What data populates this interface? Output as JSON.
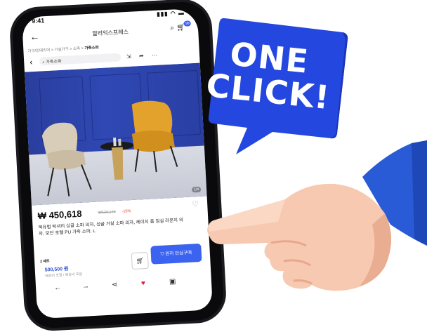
{
  "status": {
    "time": "9:41",
    "icons": "▮▮▮ ◠ ▬"
  },
  "appbar": {
    "title": "알리익스프레스",
    "cart_badge": "99"
  },
  "breadcrumb": {
    "path": "가구/인테리어 > 거실가구 > 소파 > ",
    "current": "가죽소파"
  },
  "search": {
    "value": "가죽소파"
  },
  "product": {
    "image_counter": "1/4",
    "price": "₩ 450,618",
    "original_price": "₩530,140",
    "discount": "-15%",
    "description": "북유럽 럭셔리 싱글 소파 의자, 싱글 거실 소파 의자, 레이지 홈 침실 라운지 의자, 모던 호텔 PU 가죽 소파, L"
  },
  "purchase": {
    "qty_label": "2 세트",
    "price": "500,500 원",
    "note": "배송비 포함 / 배송비 포함",
    "buy_label": "원리 안심구매"
  },
  "bubble": {
    "line1": "ONE",
    "line2": "CLICK!"
  },
  "colors": {
    "brand_blue": "#3b5cf6",
    "bubble_blue": "#2447e0",
    "sleeve_blue": "#2a5bd7"
  },
  "icons": [
    "back-icon",
    "search-icon",
    "cart-icon",
    "share-icon",
    "more-icon",
    "heart-icon",
    "home-icon"
  ]
}
